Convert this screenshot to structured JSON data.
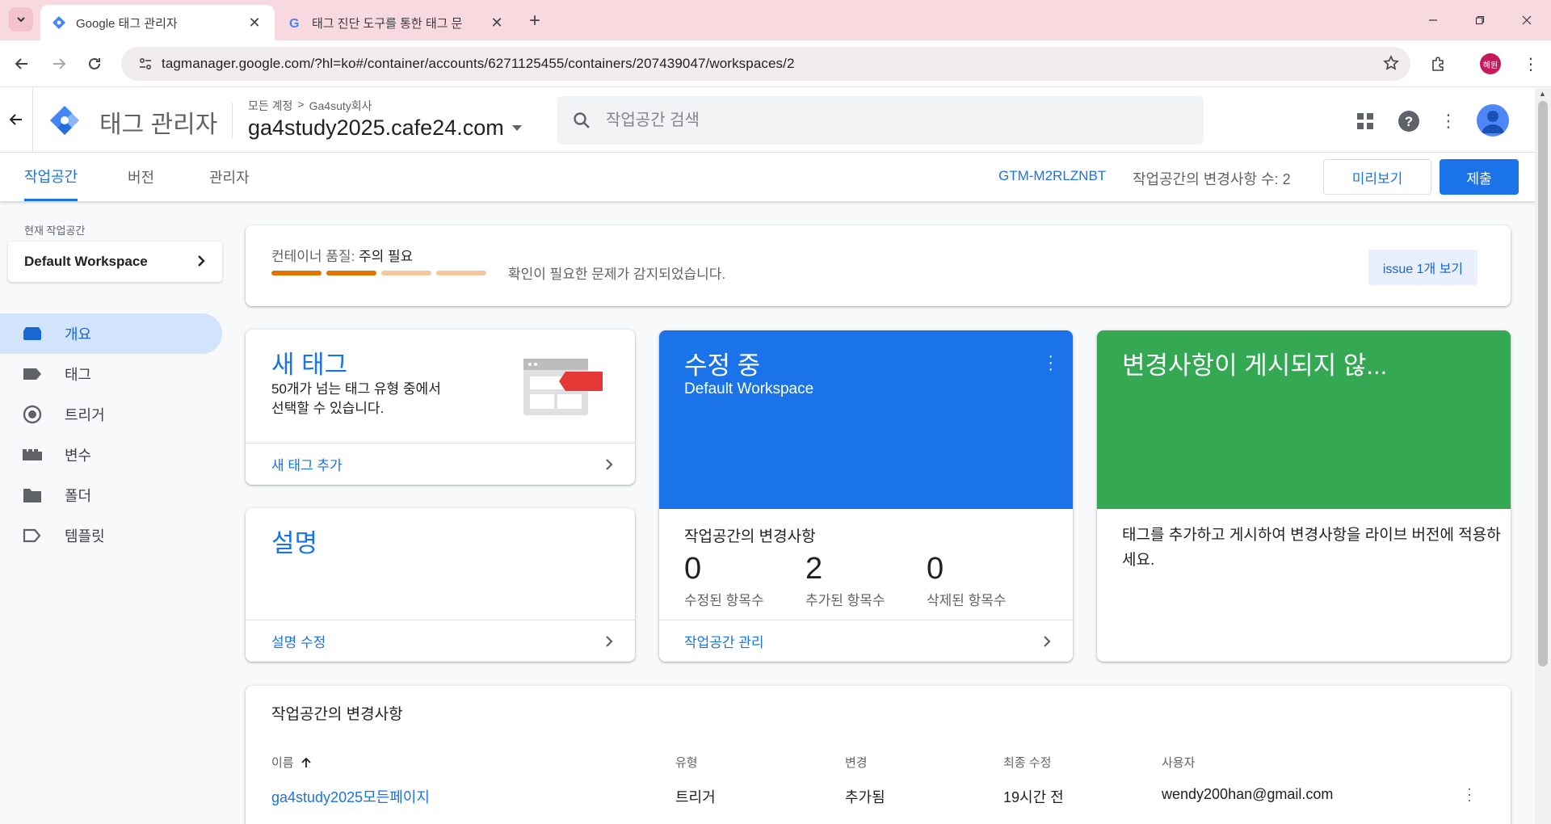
{
  "browser": {
    "tabs": [
      {
        "title": "Google 태그 관리자",
        "active": true
      },
      {
        "title": "태그 진단 도구를 통한 태그 문",
        "active": false
      }
    ],
    "url": "tagmanager.google.com/?hl=ko#/container/accounts/6271125455/containers/207439047/workspaces/2",
    "profile_initials": "혜원"
  },
  "header": {
    "product_name": "태그 관리자",
    "breadcrumb": {
      "all_accounts": "모든 계정",
      "separator": ">",
      "account": "Ga4suty회사"
    },
    "container_name": "ga4study2025.cafe24.com",
    "search_placeholder": "작업공간 검색"
  },
  "subnav": {
    "tabs": [
      {
        "label": "작업공간",
        "active": true
      },
      {
        "label": "버전",
        "active": false
      },
      {
        "label": "관리자",
        "active": false
      }
    ],
    "container_id": "GTM-M2RLZNBT",
    "changes_count": "작업공간의 변경사항 수: 2",
    "preview_label": "미리보기",
    "submit_label": "제출"
  },
  "sidebar": {
    "current_workspace_label": "현재 작업공간",
    "workspace_name": "Default Workspace",
    "items": [
      {
        "label": "개요",
        "icon": "overview-icon",
        "active": true
      },
      {
        "label": "태그",
        "icon": "tag-icon",
        "active": false
      },
      {
        "label": "트리거",
        "icon": "trigger-icon",
        "active": false
      },
      {
        "label": "변수",
        "icon": "variable-icon",
        "active": false
      },
      {
        "label": "폴더",
        "icon": "folder-icon",
        "active": false
      },
      {
        "label": "템플릿",
        "icon": "template-icon",
        "active": false
      }
    ]
  },
  "quality": {
    "label": "컨테이너 품질:",
    "status": "주의 필요",
    "message": "확인이 필요한 문제가 감지되었습니다.",
    "issue_button": "issue 1개 보기",
    "segments": [
      "#e37400",
      "#e37400",
      "#f6c79a",
      "#f6c79a"
    ]
  },
  "new_tag_card": {
    "title": "새 태그",
    "description_line1": "50개가 넘는 태그 유형 중에서",
    "description_line2": "선택할 수 있습니다.",
    "footer_link": "새 태그 추가"
  },
  "description_card": {
    "title": "설명",
    "footer_link": "설명 수정"
  },
  "editing_card": {
    "title": "수정 중",
    "workspace": "Default Workspace",
    "changes_heading": "작업공간의 변경사항",
    "stats": [
      {
        "value": "0",
        "label": "수정된 항목수"
      },
      {
        "value": "2",
        "label": "추가된 항목수"
      },
      {
        "value": "0",
        "label": "삭제된 항목수"
      }
    ],
    "footer_link": "작업공간 관리"
  },
  "publish_card": {
    "title": "변경사항이 게시되지 않...",
    "description": "태그를 추가하고 게시하여 변경사항을 라이브 버전에 적용하세요."
  },
  "changes_table": {
    "title": "작업공간의 변경사항",
    "columns": [
      "이름",
      "유형",
      "변경",
      "최종 수정",
      "사용자"
    ],
    "rows": [
      {
        "name": "ga4study2025모든페이지",
        "type": "트리거",
        "change": "추가됨",
        "modified": "19시간 전",
        "user": "wendy200han@gmail.com"
      }
    ]
  },
  "colors": {
    "accent": "#1a73e8",
    "hero_blue": "#1a73e8",
    "hero_green": "#34a853",
    "tab_strip": "#f9d9e0"
  }
}
